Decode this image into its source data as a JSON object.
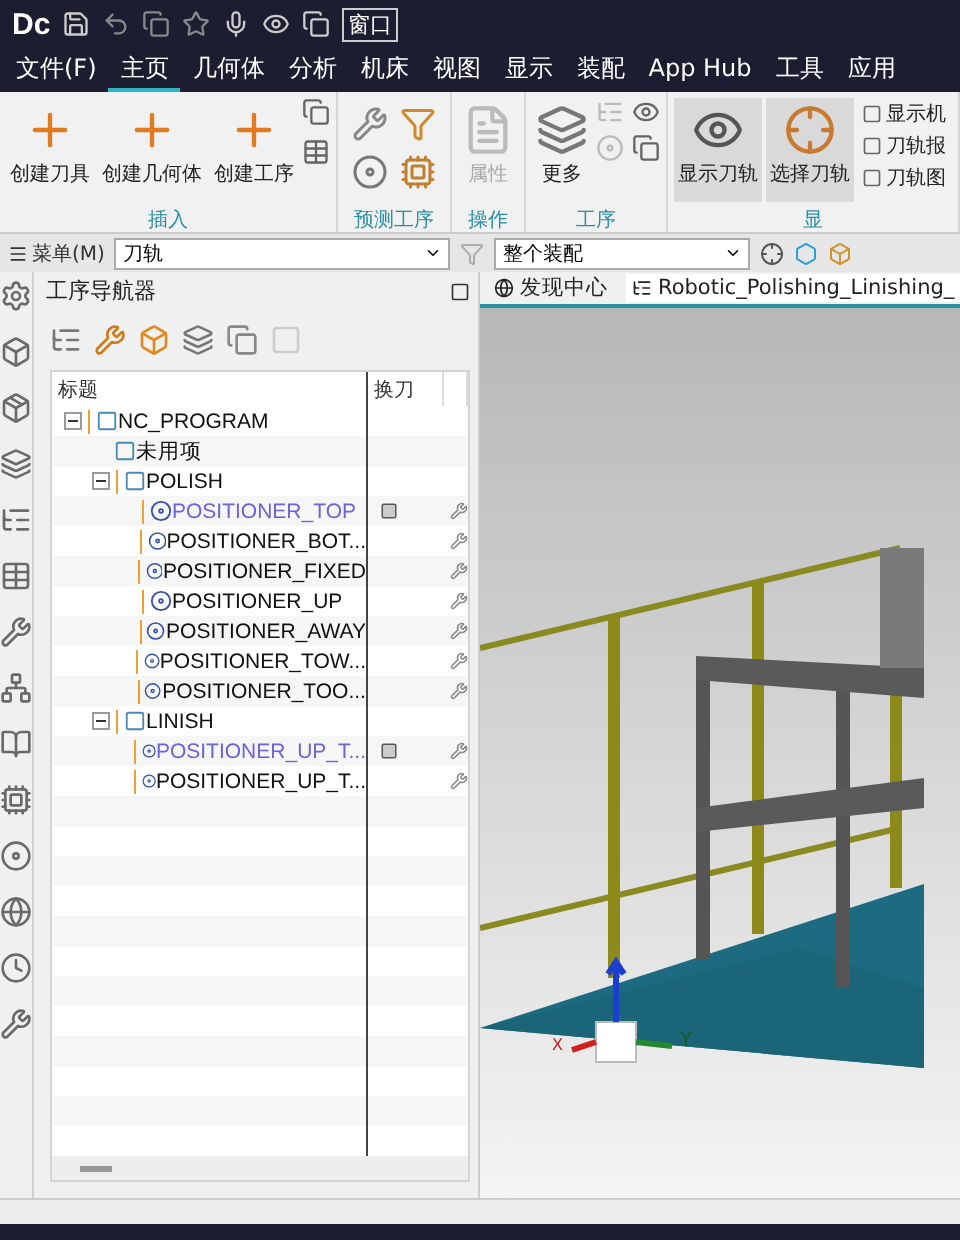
{
  "title_bar": {
    "logo": "Dc",
    "window_menu": "窗口"
  },
  "menu_tabs": [
    {
      "label": "文件(F)",
      "selected": false
    },
    {
      "label": "主页",
      "selected": true
    },
    {
      "label": "几何体",
      "selected": false
    },
    {
      "label": "分析",
      "selected": false
    },
    {
      "label": "机床",
      "selected": false
    },
    {
      "label": "视图",
      "selected": false
    },
    {
      "label": "显示",
      "selected": false
    },
    {
      "label": "装配",
      "selected": false
    },
    {
      "label": "App Hub",
      "selected": false
    },
    {
      "label": "工具",
      "selected": false
    },
    {
      "label": "应用",
      "selected": false
    }
  ],
  "ribbon": {
    "groups": [
      {
        "label": "插入",
        "buttons": [
          {
            "label": "创建刀具",
            "disabled": false,
            "selected": false
          },
          {
            "label": "创建几何体",
            "disabled": false,
            "selected": false
          },
          {
            "label": "创建工序",
            "disabled": false,
            "selected": false
          }
        ]
      },
      {
        "label": "预测工序"
      },
      {
        "label": "操作",
        "buttons": [
          {
            "label": "属性",
            "disabled": true,
            "selected": false
          }
        ]
      },
      {
        "label": "工序",
        "buttons": [
          {
            "label": "更多",
            "disabled": false,
            "selected": false
          }
        ]
      },
      {
        "label": "显",
        "buttons": [
          {
            "label": "显示刀轨",
            "disabled": false,
            "selected": true
          },
          {
            "label": "选择刀轨",
            "disabled": false,
            "selected": true
          }
        ],
        "small": [
          "显示机",
          "刀轨报",
          "刀轨图"
        ]
      }
    ]
  },
  "toolbar": {
    "menu": "菜单(M)",
    "filter": "刀轨",
    "scope": "整个装配"
  },
  "navigator": {
    "title": "工序导航器",
    "columns": [
      {
        "label": "标题"
      },
      {
        "label": "换刀"
      },
      {}
    ],
    "tree": [
      {
        "label": "NC_PROGRAM",
        "kind": "group",
        "expanded": true,
        "children": [
          {
            "label": "未用项",
            "kind": "group"
          },
          {
            "label": "POLISH",
            "kind": "group",
            "expanded": true,
            "children": [
              {
                "label": "POSITIONER_TOP",
                "kind": "operation",
                "tool_change": true
              },
              {
                "label": "POSITIONER_BOT...",
                "kind": "operation",
                "tool_change": false
              },
              {
                "label": "POSITIONER_FIXED",
                "kind": "operation",
                "tool_change": false
              },
              {
                "label": "POSITIONER_UP",
                "kind": "operation",
                "tool_change": false
              },
              {
                "label": "POSITIONER_AWAY",
                "kind": "operation",
                "tool_change": false
              },
              {
                "label": "POSITIONER_TOW...",
                "kind": "operation",
                "tool_change": false
              },
              {
                "label": "POSITIONER_TOO...",
                "kind": "operation",
                "tool_change": false
              }
            ]
          },
          {
            "label": "LINISH",
            "kind": "group",
            "expanded": true,
            "children": [
              {
                "label": "POSITIONER_UP_T...",
                "kind": "operation",
                "tool_change": true
              },
              {
                "label": "POSITIONER_UP_T...",
                "kind": "operation",
                "tool_change": false
              }
            ]
          }
        ]
      }
    ]
  },
  "viewport": {
    "tabs": [
      {
        "label": "发现中心",
        "selected": false
      },
      {
        "label": "Robotic_Polishing_Linishing_",
        "selected": true
      }
    ],
    "axes": [
      "X",
      "Y"
    ]
  }
}
